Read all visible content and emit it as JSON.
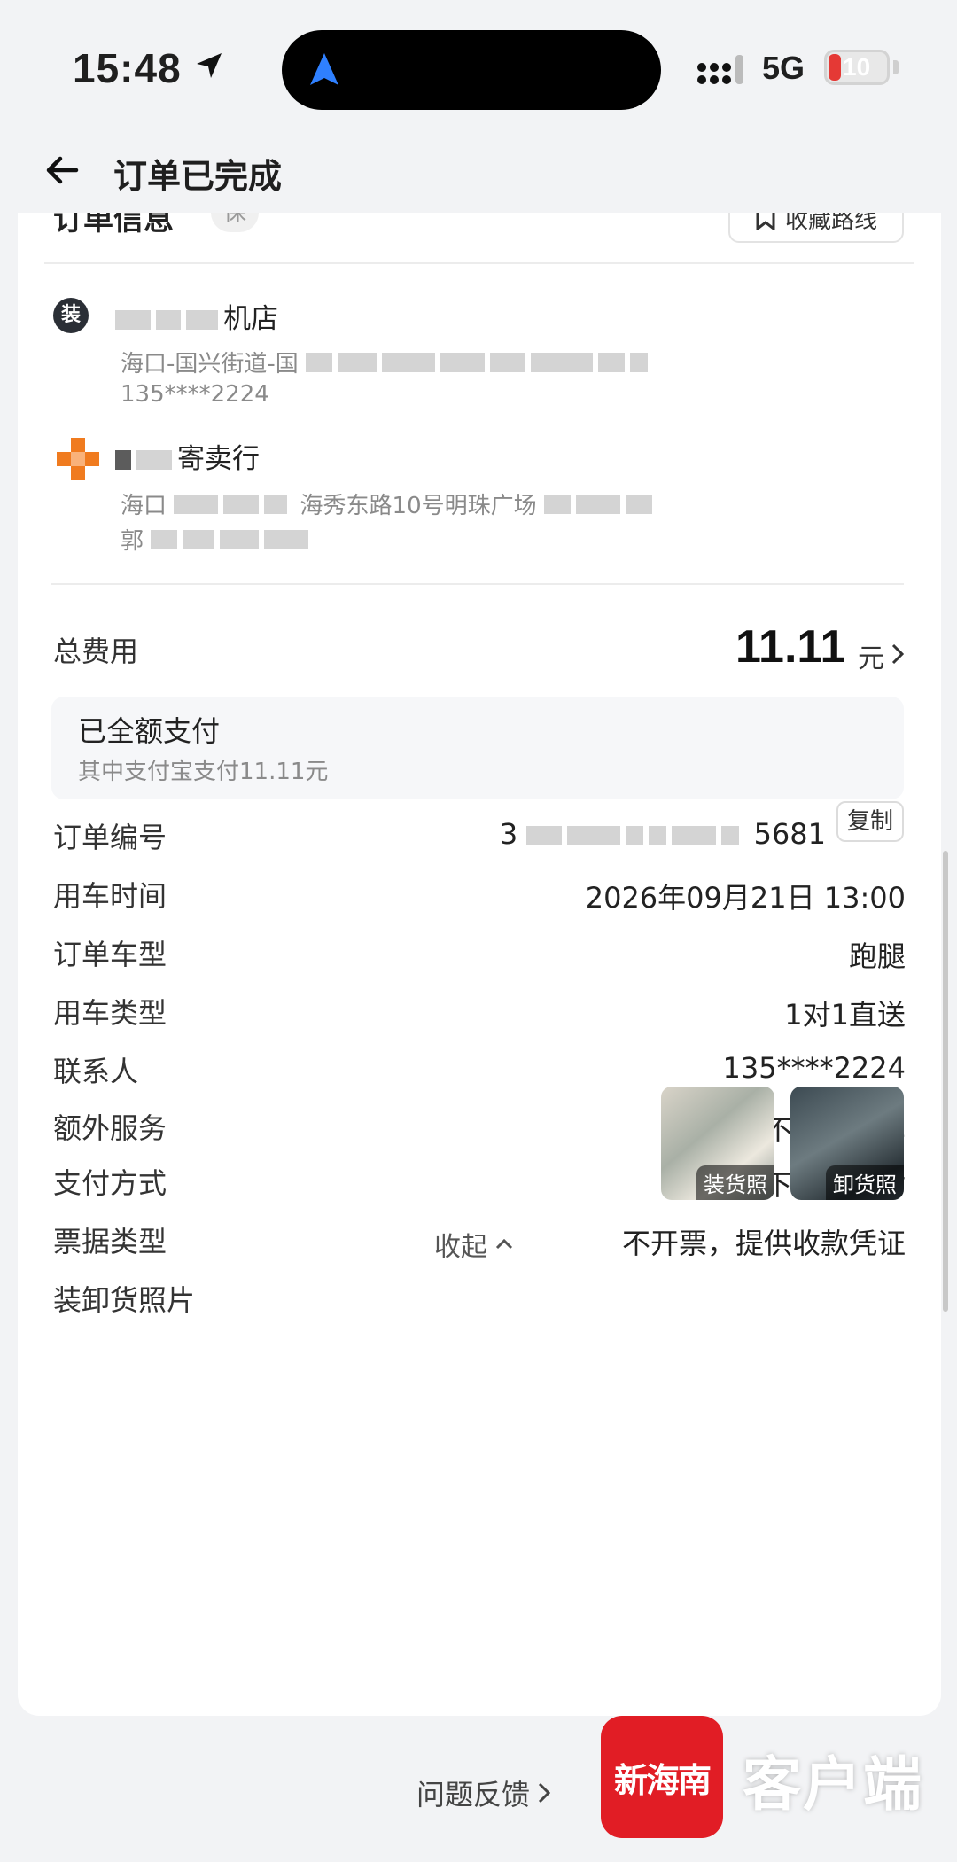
{
  "status_bar": {
    "time": "15:48",
    "network": "5G",
    "battery": "10"
  },
  "nav": {
    "title": "订单已完成"
  },
  "card_header": {
    "title": "订单信息",
    "badge": "保",
    "favorite_label": "收藏路线"
  },
  "load_address": {
    "icon_label": "装",
    "name": "机店",
    "line1": "海口-国兴街道-国",
    "phone": "135****2224"
  },
  "unload_address": {
    "name": "寄卖行",
    "line1_a": "海口",
    "line1_b": "海秀东路10号明珠广场",
    "contact": "郭"
  },
  "fee": {
    "label": "总费用",
    "amount": "11.11",
    "unit": "元",
    "paid_status": "已全额支付",
    "paid_detail": "其中支付宝支付11.11元"
  },
  "details": {
    "order_no_label": "订单编号",
    "order_no_prefix": "3",
    "order_no_suffix": "5681",
    "copy_label": "复制",
    "time_label": "用车时间",
    "time_value": "2026年09月21日 13:00",
    "vehicle_label": "订单车型",
    "vehicle_value": "跑腿",
    "use_type_label": "用车类型",
    "use_type_value": "1对1直送",
    "contact_label": "联系人",
    "contact_value": "135****2224",
    "extra_label": "额外服务",
    "extra_value": "不允许跟车",
    "pay_method_label": "支付方式",
    "pay_method_value": "下单人预付",
    "invoice_label": "票据类型",
    "invoice_value": "不开票，提供收款凭证",
    "photos_label": "装卸货照片",
    "photo_load_tag": "装货照",
    "photo_unload_tag": "卸货照"
  },
  "collapse_label": "收起",
  "feedback_label": "问题反馈",
  "watermark": {
    "logo_text": "新海南",
    "text": "客户端"
  },
  "colors": {
    "background": "#f2f3f5",
    "card": "#ffffff",
    "brand_red": "#e11d25",
    "shop_orange": "#f07b1f"
  }
}
